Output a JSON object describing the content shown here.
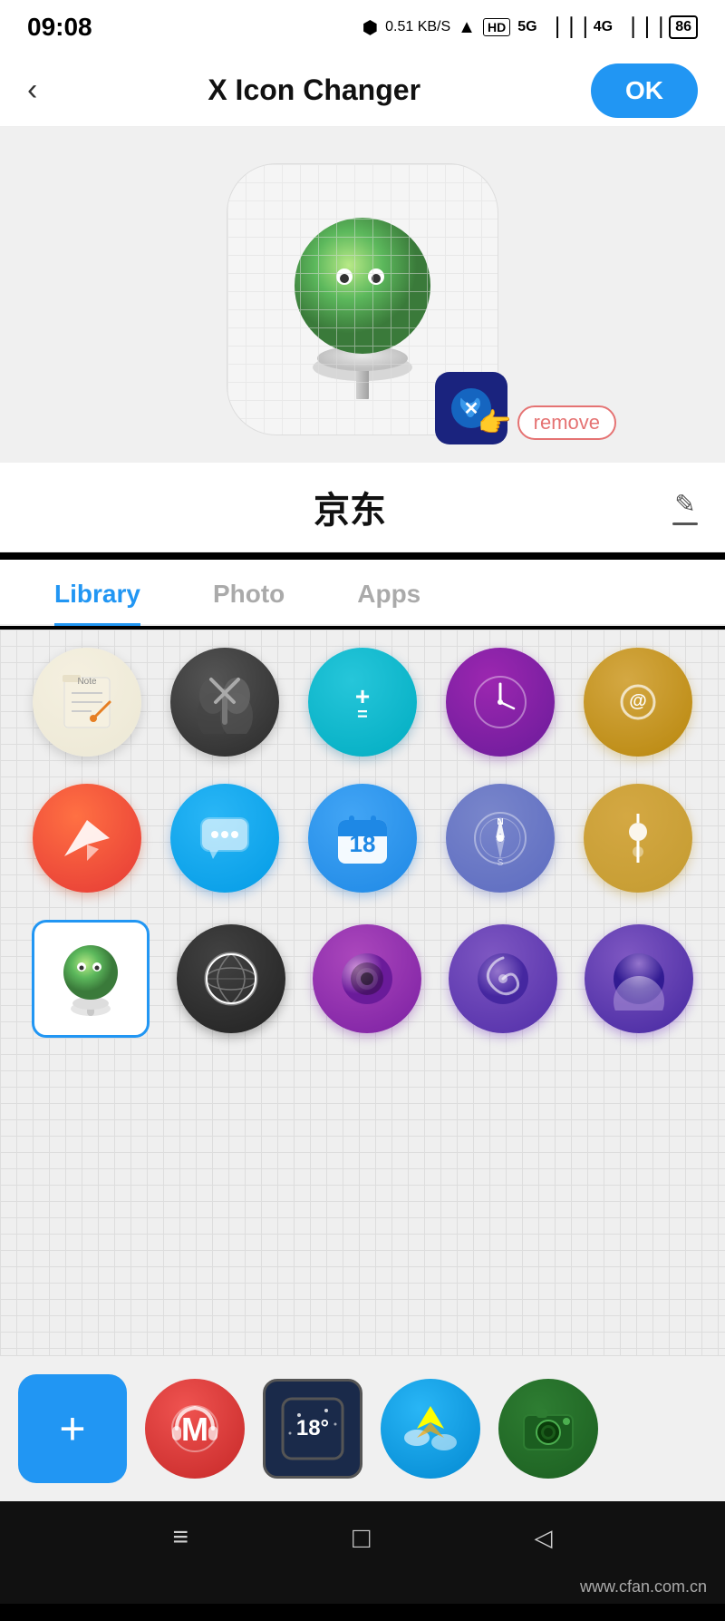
{
  "statusBar": {
    "time": "09:08",
    "network": "0.51 KB/S",
    "batteryLevel": "86"
  },
  "header": {
    "backLabel": "‹",
    "title": "X Icon Changer",
    "okLabel": "OK"
  },
  "appName": {
    "text": "京东"
  },
  "tabs": [
    {
      "id": "library",
      "label": "Library",
      "active": true
    },
    {
      "id": "photo",
      "label": "Photo",
      "active": false
    },
    {
      "id": "apps",
      "label": "Apps",
      "active": false
    }
  ],
  "icons": {
    "row1": [
      {
        "id": "note",
        "type": "note",
        "label": "Note"
      },
      {
        "id": "scissors",
        "type": "scissors",
        "label": "Scissors"
      },
      {
        "id": "calculator",
        "type": "calc",
        "label": "Calculator"
      },
      {
        "id": "clock",
        "type": "clock",
        "label": "Clock"
      },
      {
        "id": "email",
        "type": "email",
        "label": "Email"
      }
    ],
    "row2": [
      {
        "id": "paperplane",
        "type": "paper-plane",
        "label": "Paper Plane"
      },
      {
        "id": "chat",
        "type": "chat",
        "label": "Chat"
      },
      {
        "id": "calendar",
        "type": "cal",
        "label": "Calendar",
        "text": "18"
      },
      {
        "id": "compass",
        "type": "compass",
        "label": "Compass"
      },
      {
        "id": "settings2",
        "type": "settings2",
        "label": "Settings"
      }
    ],
    "row3": [
      {
        "id": "lollipop",
        "type": "lollipop-selected",
        "label": "Lollipop",
        "selected": true
      },
      {
        "id": "world",
        "type": "world",
        "label": "World"
      },
      {
        "id": "camera-lens",
        "type": "camera",
        "label": "Camera"
      },
      {
        "id": "spiral",
        "type": "spiral",
        "label": "Spiral"
      },
      {
        "id": "wallpaper",
        "type": "wallpaper",
        "label": "Wallpaper"
      }
    ]
  },
  "bottom": {
    "addLabel": "+",
    "icons": [
      {
        "id": "media",
        "type": "bottom-m",
        "label": "Media"
      },
      {
        "id": "weather",
        "type": "bottom-weather",
        "label": "Weather",
        "temp": "18°"
      },
      {
        "id": "plane-game",
        "type": "bottom-plane",
        "label": "Plane Game"
      },
      {
        "id": "retro-cam",
        "type": "bottom-camera",
        "label": "Retro Camera"
      }
    ]
  },
  "navBar": {
    "menuIcon": "≡",
    "homeIcon": "□",
    "backIcon": "◁"
  },
  "watermark": "www.cfan.com.cn",
  "removeLabel": "remove",
  "overlayIcon": "X"
}
